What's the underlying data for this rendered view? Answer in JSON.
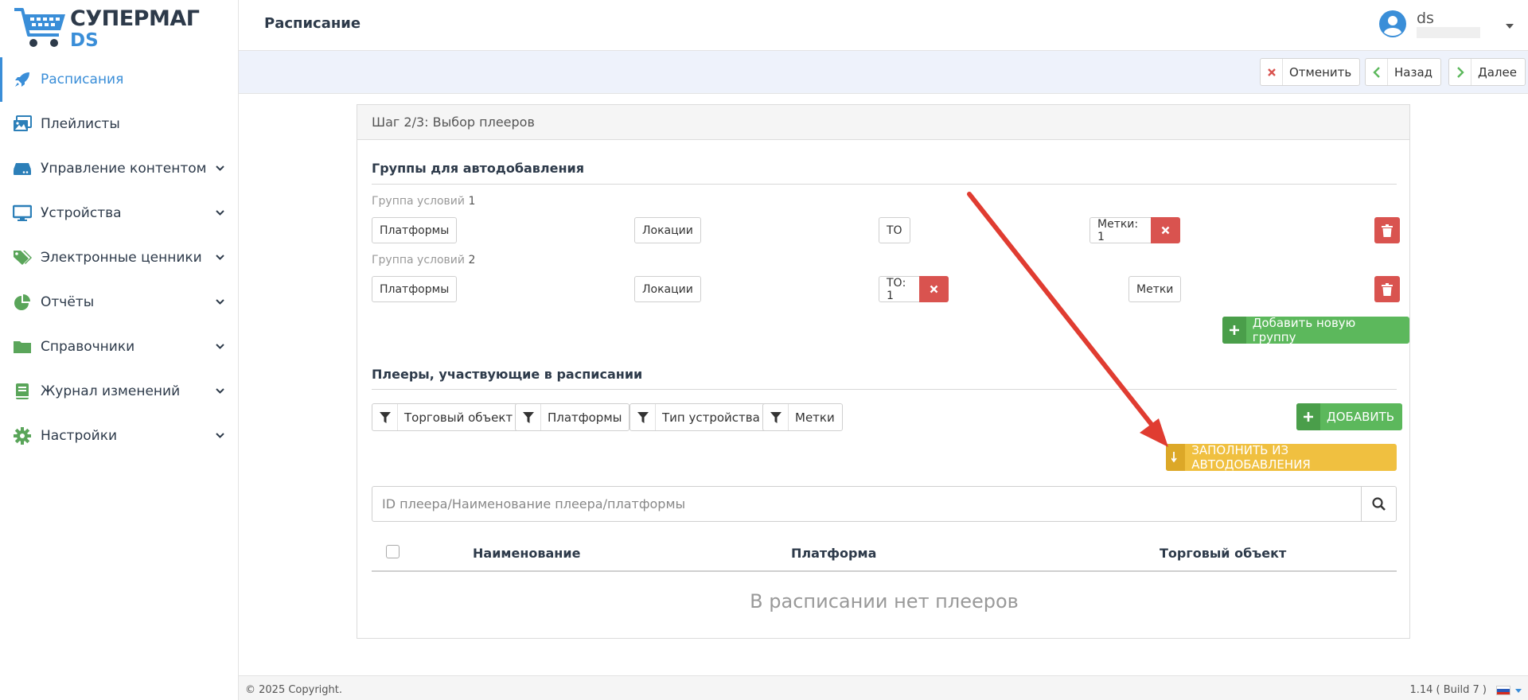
{
  "logo": {
    "line1": "СУПЕРМАГ",
    "line2": "DS"
  },
  "sidebar": {
    "items": [
      {
        "label": "Расписания",
        "icon": "rocket-icon",
        "active": true,
        "expandable": false
      },
      {
        "label": "Плейлисты",
        "icon": "images-icon",
        "active": false,
        "expandable": false
      },
      {
        "label": "Управление контентом",
        "icon": "hdd-icon",
        "active": false,
        "expandable": true
      },
      {
        "label": "Устройства",
        "icon": "monitor-icon",
        "active": false,
        "expandable": true
      },
      {
        "label": "Электронные ценники",
        "icon": "tags-icon",
        "active": false,
        "expandable": true
      },
      {
        "label": "Отчёты",
        "icon": "pie-chart-icon",
        "active": false,
        "expandable": true
      },
      {
        "label": "Справочники",
        "icon": "folder-icon",
        "active": false,
        "expandable": true
      },
      {
        "label": "Журнал изменений",
        "icon": "book-icon",
        "active": false,
        "expandable": true
      },
      {
        "label": "Настройки",
        "icon": "gear-icon",
        "active": false,
        "expandable": true
      }
    ]
  },
  "header": {
    "title": "Расписание",
    "username": "ds"
  },
  "actions": {
    "cancel": "Отменить",
    "back": "Назад",
    "next": "Далее"
  },
  "card": {
    "title": "Шаг 2/3: Выбор плееров",
    "autoadd": {
      "title": "Группы для автодобавления",
      "group_label": "Группа условий",
      "groups": [
        {
          "num": "1",
          "platforms": "Платформы",
          "locations": "Локации",
          "to": "ТО",
          "tags": "Метки: 1"
        },
        {
          "num": "2",
          "platforms": "Платформы",
          "locations": "Локации",
          "to": "ТО: 1",
          "tags": "Метки"
        }
      ],
      "add_group": "Добавить новую группу"
    },
    "players": {
      "title": "Плееры, участвующие в расписании",
      "filters": [
        "Торговый объект",
        "Платформы",
        "Тип устройства",
        "Метки"
      ],
      "add": "ДОБАВИТЬ",
      "fill": "ЗАПОЛНИТЬ ИЗ АВТОДОБАВЛЕНИЯ",
      "search_placeholder": "ID плеера/Наименование плеера/платформы",
      "columns": [
        "Наименование",
        "Платформа",
        "Торговый объект"
      ],
      "empty": "В расписании нет плееров"
    }
  },
  "footer": {
    "copyright": "© 2025 Copyright.",
    "version": "1.14 ( Build 7 )"
  },
  "colors": {
    "accent": "#3a8ed8",
    "success": "#5cb85c",
    "danger": "#d9534f",
    "warning": "#f0c040",
    "annotation": "#e03c31"
  }
}
